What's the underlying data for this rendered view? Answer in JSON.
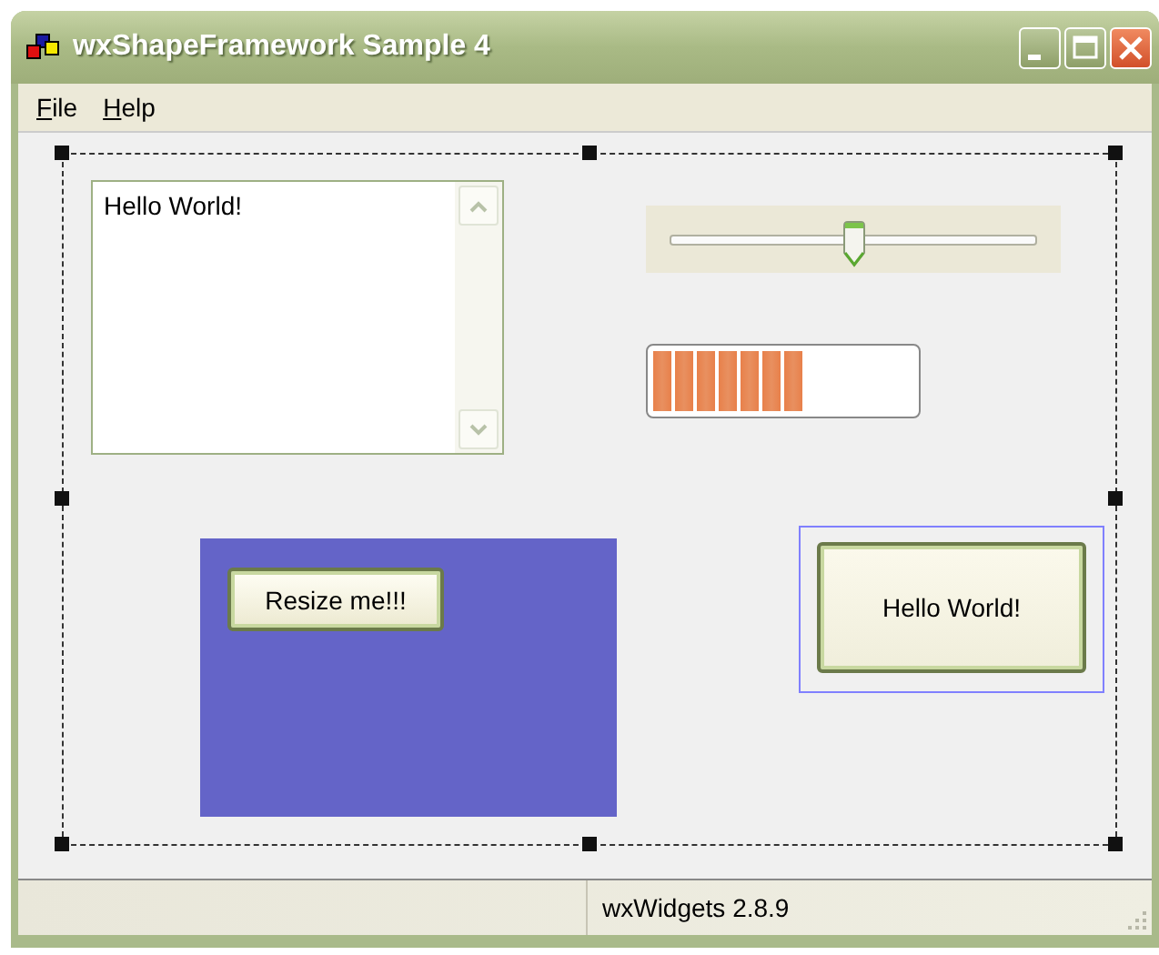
{
  "window": {
    "title": "wxShapeFramework Sample 4"
  },
  "menu": [
    {
      "mnemonic": "F",
      "rest": "ile"
    },
    {
      "mnemonic": "H",
      "rest": "elp"
    }
  ],
  "canvas": {
    "text_box": {
      "value": "Hello World!"
    },
    "slider": {
      "level": 0.5
    },
    "rectangle": {
      "color": "#6464c8",
      "button": "Resize me!!!"
    },
    "button": {
      "label": "Hello World!"
    }
  },
  "status_bar": {
    "text": "wxWidgets 2.8.9"
  }
}
